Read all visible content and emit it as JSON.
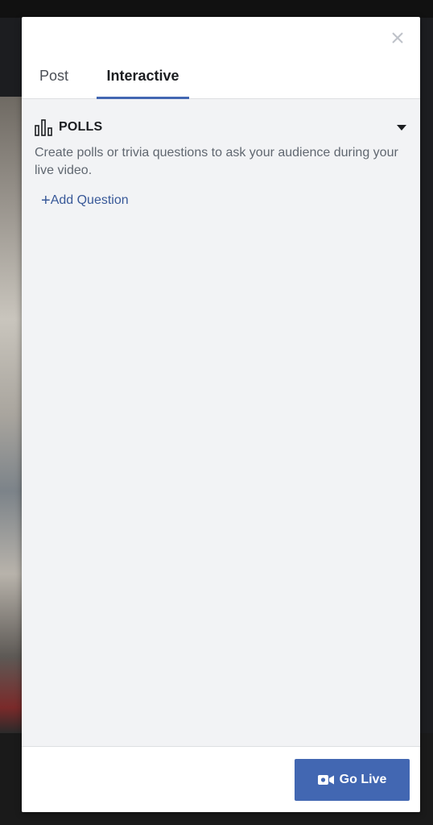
{
  "dialog": {
    "tabs": [
      {
        "label": "Post",
        "active": false
      },
      {
        "label": "Interactive",
        "active": true
      }
    ]
  },
  "polls": {
    "icon": "bar-chart-icon",
    "title": "POLLS",
    "description": "Create polls or trivia questions to ask your audience during your live video.",
    "add_question_plus": "+",
    "add_question_label": "Add Question"
  },
  "footer": {
    "go_live_label": "Go Live",
    "go_live_icon": "video-camera-icon"
  },
  "colors": {
    "accent": "#4267b2",
    "link": "#385898",
    "content_bg": "#f2f3f5"
  }
}
